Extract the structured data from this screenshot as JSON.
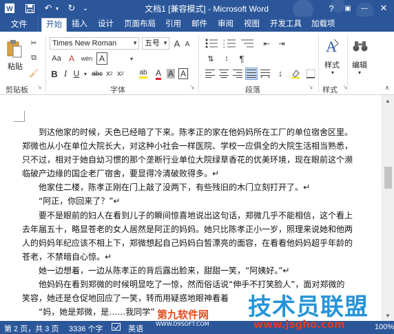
{
  "titlebar": {
    "title": "文档1 [兼容模式] - Microsoft Word",
    "help": "?",
    "minimize": "—",
    "restore": "▭",
    "close": "✕"
  },
  "tabs": {
    "file": "文件",
    "items": [
      "开始",
      "插入",
      "设计",
      "页面布局",
      "引用",
      "邮件",
      "审阅",
      "视图",
      "开发工具",
      "加载项"
    ]
  },
  "ribbon": {
    "clipboard": {
      "paste": "粘贴",
      "label": "剪贴板"
    },
    "font": {
      "font_name": "Times New Roman",
      "font_size": "五号",
      "label": "字体",
      "grow": "A",
      "shrink": "A",
      "aa": "Aa",
      "clear": "A",
      "wen": "wén",
      "a_box": "A",
      "bold": "B",
      "italic": "I",
      "underline": "U",
      "strike": "abc",
      "sub": "x",
      "sup": "x",
      "highlight": "ab",
      "color": "A",
      "shade": "A",
      "char_border": "A"
    },
    "paragraph": {
      "label": "段落"
    },
    "styles": {
      "label": "样式",
      "button": "样式"
    },
    "editing": {
      "button": "编辑"
    }
  },
  "document": {
    "paragraphs": [
      "　　到达他家的时候，天色已经暗了下来。陈孝正的家在他妈妈所在工厂的单位宿舍区里。",
      "郑微也从小在单位大院长大，对这种小社会一样医院、学校一应俱全的大院生活相当熟悉，",
      "只不过，相对于她自幼习惯的那个垄断行业单位大院绿草香花的优美环境，现在眼前这个濒",
      "临破产边缘的国企老厂宿舍，要显得冷清破败得多。↵",
      "　　他家住二楼，陈孝正刚在门上敲了没两下，有些残旧的木门立刻打开了。↵",
      "　　“阿正，你回来了？”↵",
      "　　要不是眼前的妇人在看到儿子的瞬间惊喜地说出这句话，郑微几乎不能相信，这个看上",
      "去年届五十，略显苍老的女人居然是阿正的妈妈。她只比陈孝正小一岁，照理来说她和他两",
      "人的妈妈年纪应该不相上下，郑微想起自己妈妈白皙漂亮的面容，在看看他妈妈超乎年龄的",
      "苍老，不禁暗自心惊。↵",
      "　　她一边想着，一边从陈孝正的背后露出脸来，甜甜一笑，“阿姨好。”↵",
      "　　他妈妈在看到郑微的时候明显吃了一惊，然而俗话说“伸手不打笑脸人”，面对郑微的",
      "笑容，她还是仓促地回应了一笑，转而用疑惑地眼神看着",
      "　　“妈，她是郑微，是……我同学”"
    ]
  },
  "statusbar": {
    "page": "第 2 页，共 3 页",
    "words": "3336 个字",
    "lang": "英语",
    "zoom": "100%"
  },
  "watermark": {
    "main": "技术员联盟",
    "site1": "第九软件网",
    "site1_url": "WWW.D9SOFT.COM",
    "site2": "www.jsgho.com"
  }
}
